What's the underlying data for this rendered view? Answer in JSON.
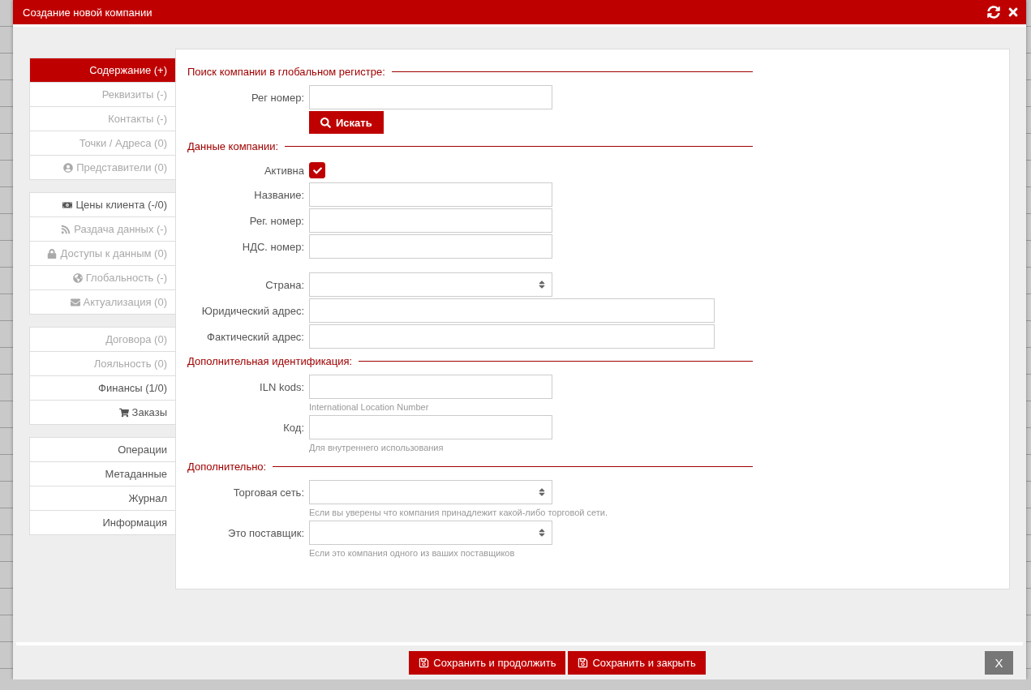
{
  "window": {
    "title": "Создание новой компании"
  },
  "sidebar": {
    "groups": [
      {
        "items": [
          {
            "label": "Содержание (+)",
            "selected": true,
            "disabled": false
          },
          {
            "label": "Реквизиты (-)",
            "selected": false,
            "disabled": true
          },
          {
            "label": "Контакты (-)",
            "selected": false,
            "disabled": true
          },
          {
            "label": "Точки / Адреса (0)",
            "selected": false,
            "disabled": true
          },
          {
            "label": "Представители (0)",
            "selected": false,
            "disabled": true
          }
        ]
      },
      {
        "items": [
          {
            "label": "Цены клиента (-/0)",
            "selected": false,
            "disabled": false
          },
          {
            "label": "Раздача данных (-)",
            "selected": false,
            "disabled": true
          },
          {
            "label": "Доступы к данным (0)",
            "selected": false,
            "disabled": true
          },
          {
            "label": "Глобальность (-)",
            "selected": false,
            "disabled": true
          },
          {
            "label": "Актуализация (0)",
            "selected": false,
            "disabled": true
          }
        ]
      },
      {
        "items": [
          {
            "label": "Договора (0)",
            "selected": false,
            "disabled": true
          },
          {
            "label": "Лояльность (0)",
            "selected": false,
            "disabled": true
          },
          {
            "label": "Финансы (1/0)",
            "selected": false,
            "disabled": false
          },
          {
            "label": "Заказы",
            "selected": false,
            "disabled": false
          }
        ]
      },
      {
        "items": [
          {
            "label": "Операции",
            "selected": false,
            "disabled": false
          },
          {
            "label": "Метаданные",
            "selected": false,
            "disabled": false
          },
          {
            "label": "Журнал",
            "selected": false,
            "disabled": false
          },
          {
            "label": "Информация",
            "selected": false,
            "disabled": false
          }
        ]
      }
    ]
  },
  "sections": [
    {
      "title": "Поиск компании в глобальном регистре:",
      "rows": [
        {
          "kind": "input",
          "label": "Рег номер:",
          "wide": false
        },
        {
          "kind": "button",
          "label": "Искать"
        }
      ]
    },
    {
      "title": "Данные компании:",
      "rows": [
        {
          "kind": "checkbox",
          "label": "Активна",
          "checked": true
        },
        {
          "kind": "input",
          "label": "Название:",
          "wide": false
        },
        {
          "kind": "input",
          "label": "Рег. номер:",
          "wide": false
        },
        {
          "kind": "input",
          "label": "НДС. номер:",
          "wide": false
        },
        {
          "kind": "spacer"
        },
        {
          "kind": "select",
          "label": "Страна:"
        },
        {
          "kind": "input",
          "label": "Юридический адрес:",
          "wide": true
        },
        {
          "kind": "input",
          "label": "Фактический адрес:",
          "wide": true
        }
      ]
    },
    {
      "title": "Дополнительная идентификация:",
      "rows": [
        {
          "kind": "input",
          "label": "ILN kods:",
          "wide": false,
          "hint": "International Location Number"
        },
        {
          "kind": "input",
          "label": "Код:",
          "wide": false,
          "hint": "Для внутреннего использования"
        }
      ]
    },
    {
      "title": "Дополнительно:",
      "rows": [
        {
          "kind": "select",
          "label": "Торговая сеть:",
          "hint": "Если вы уверены что компания принадлежит какой-либо торговой сети."
        },
        {
          "kind": "select",
          "label": "Это поставщик:",
          "hint": "Если это компания одного из ваших поставщиков"
        }
      ]
    }
  ],
  "footer": {
    "buttons": [
      {
        "kind": "save",
        "label": "Сохранить и продолжить"
      },
      {
        "kind": "save",
        "label": "Сохранить и закрыть"
      }
    ],
    "close": {
      "label": "X"
    }
  }
}
